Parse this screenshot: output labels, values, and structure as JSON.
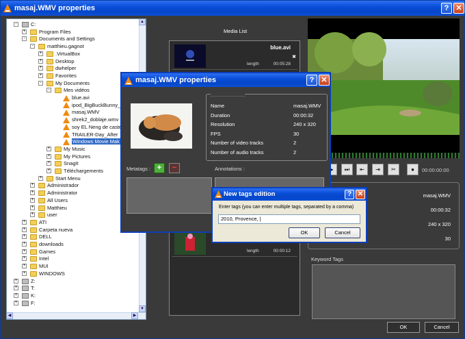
{
  "window": {
    "title": "masaj.WMV properties"
  },
  "tree": {
    "items": [
      {
        "label": "C:",
        "indent": 0,
        "icon": "drive",
        "exp": "-"
      },
      {
        "label": "Program Files",
        "indent": 1,
        "icon": "folder",
        "exp": "+"
      },
      {
        "label": "Documents and Settings",
        "indent": 1,
        "icon": "folder",
        "exp": "-"
      },
      {
        "label": "matthieu.gagnot",
        "indent": 2,
        "icon": "folder",
        "exp": "-"
      },
      {
        "label": ".VirtualBox",
        "indent": 3,
        "icon": "folder",
        "exp": "+"
      },
      {
        "label": "Desktop",
        "indent": 3,
        "icon": "folder",
        "exp": "+"
      },
      {
        "label": "dwhelper",
        "indent": 3,
        "icon": "folder",
        "exp": "+"
      },
      {
        "label": "Favorites",
        "indent": 3,
        "icon": "folder",
        "exp": "+"
      },
      {
        "label": "My Documents",
        "indent": 3,
        "icon": "folder",
        "exp": "-"
      },
      {
        "label": "Mes vidéos",
        "indent": 4,
        "icon": "folder",
        "exp": "-"
      },
      {
        "label": "blue.avi",
        "indent": 5,
        "icon": "vlc",
        "exp": ""
      },
      {
        "label": "ipod_BigBuckBunny_",
        "indent": 5,
        "icon": "vlc",
        "exp": ""
      },
      {
        "label": "masaj.WMV",
        "indent": 5,
        "icon": "vlc",
        "exp": ""
      },
      {
        "label": "shrek2_doblaje.wmv",
        "indent": 5,
        "icon": "vlc",
        "exp": ""
      },
      {
        "label": "soy EL Neng de caste",
        "indent": 5,
        "icon": "vlc",
        "exp": ""
      },
      {
        "label": "TRAILER-Day_After",
        "indent": 5,
        "icon": "vlc",
        "exp": ""
      },
      {
        "label": "Windows Movie Mak",
        "indent": 5,
        "icon": "vlc",
        "exp": "",
        "selected": true
      },
      {
        "label": "My Music",
        "indent": 4,
        "icon": "folder",
        "exp": "+"
      },
      {
        "label": "My Pictures",
        "indent": 4,
        "icon": "folder",
        "exp": "+"
      },
      {
        "label": "SnagIt",
        "indent": 4,
        "icon": "folder",
        "exp": "+"
      },
      {
        "label": "Téléchargements",
        "indent": 4,
        "icon": "folder",
        "exp": "+"
      },
      {
        "label": "Start Menu",
        "indent": 3,
        "icon": "folder",
        "exp": "+"
      },
      {
        "label": "Administrador",
        "indent": 2,
        "icon": "folder",
        "exp": "+"
      },
      {
        "label": "Administrator",
        "indent": 2,
        "icon": "folder",
        "exp": "+"
      },
      {
        "label": "All Users",
        "indent": 2,
        "icon": "folder",
        "exp": "+"
      },
      {
        "label": "Matthieu",
        "indent": 2,
        "icon": "folder",
        "exp": "+"
      },
      {
        "label": "user",
        "indent": 2,
        "icon": "folder",
        "exp": "+"
      },
      {
        "label": "ATI",
        "indent": 1,
        "icon": "folder",
        "exp": "+"
      },
      {
        "label": "Carpeta nueva",
        "indent": 1,
        "icon": "folder",
        "exp": "+"
      },
      {
        "label": "DELL",
        "indent": 1,
        "icon": "folder",
        "exp": "+"
      },
      {
        "label": "downloads",
        "indent": 1,
        "icon": "folder",
        "exp": "+"
      },
      {
        "label": "Games",
        "indent": 1,
        "icon": "folder",
        "exp": "+"
      },
      {
        "label": "Intel",
        "indent": 1,
        "icon": "folder",
        "exp": "+"
      },
      {
        "label": "MUI",
        "indent": 1,
        "icon": "folder",
        "exp": "+"
      },
      {
        "label": "WINDOWS",
        "indent": 1,
        "icon": "folder",
        "exp": "+"
      },
      {
        "label": "Z:",
        "indent": 0,
        "icon": "drive",
        "exp": "+"
      },
      {
        "label": "T:",
        "indent": 0,
        "icon": "drive",
        "exp": "+"
      },
      {
        "label": "K:",
        "indent": 0,
        "icon": "drive",
        "exp": "+"
      },
      {
        "label": "F:",
        "indent": 0,
        "icon": "drive",
        "exp": "+"
      }
    ]
  },
  "media_list": {
    "title": "Media List",
    "items": [
      {
        "name": "blue.avi",
        "length_label": "length",
        "duration": "00:05:28"
      },
      {
        "name": "",
        "length_label": "length",
        "duration": "00:00:12"
      }
    ]
  },
  "player": {
    "timecode": "00:00:00:00"
  },
  "info_right": {
    "values": [
      "masaj.WMV",
      "00:00:32",
      "240 x 320",
      "30"
    ]
  },
  "keyword_tags": {
    "title": "Keyword Tags"
  },
  "footer": {
    "ok_label": "OK",
    "cancel_label": "Cancel"
  },
  "properties_dialog": {
    "title": "masaj.WMV properties",
    "rows": [
      {
        "label": "Name",
        "value": "masaj.WMV"
      },
      {
        "label": "Duration",
        "value": "00:00:32"
      },
      {
        "label": "Resolution",
        "value": "240 x 320"
      },
      {
        "label": "FPS",
        "value": "30"
      },
      {
        "label": "Number of video tracks",
        "value": "2"
      },
      {
        "label": "Number of audio tracks",
        "value": "2"
      }
    ],
    "metatags_label": "Metatags :",
    "annotations_label": "Annotations :"
  },
  "tags_dialog": {
    "title": "New tags edition",
    "prompt": "Enter tags (you can enter multiple tags, separated by a comma)",
    "input_value": "2010, Provence, |",
    "ok_label": "OK",
    "cancel_label": "Cancel"
  },
  "colors": {
    "titlebar": "#0a4ed8",
    "selection": "#316ac5",
    "dark_bg": "#3a3a3a"
  }
}
